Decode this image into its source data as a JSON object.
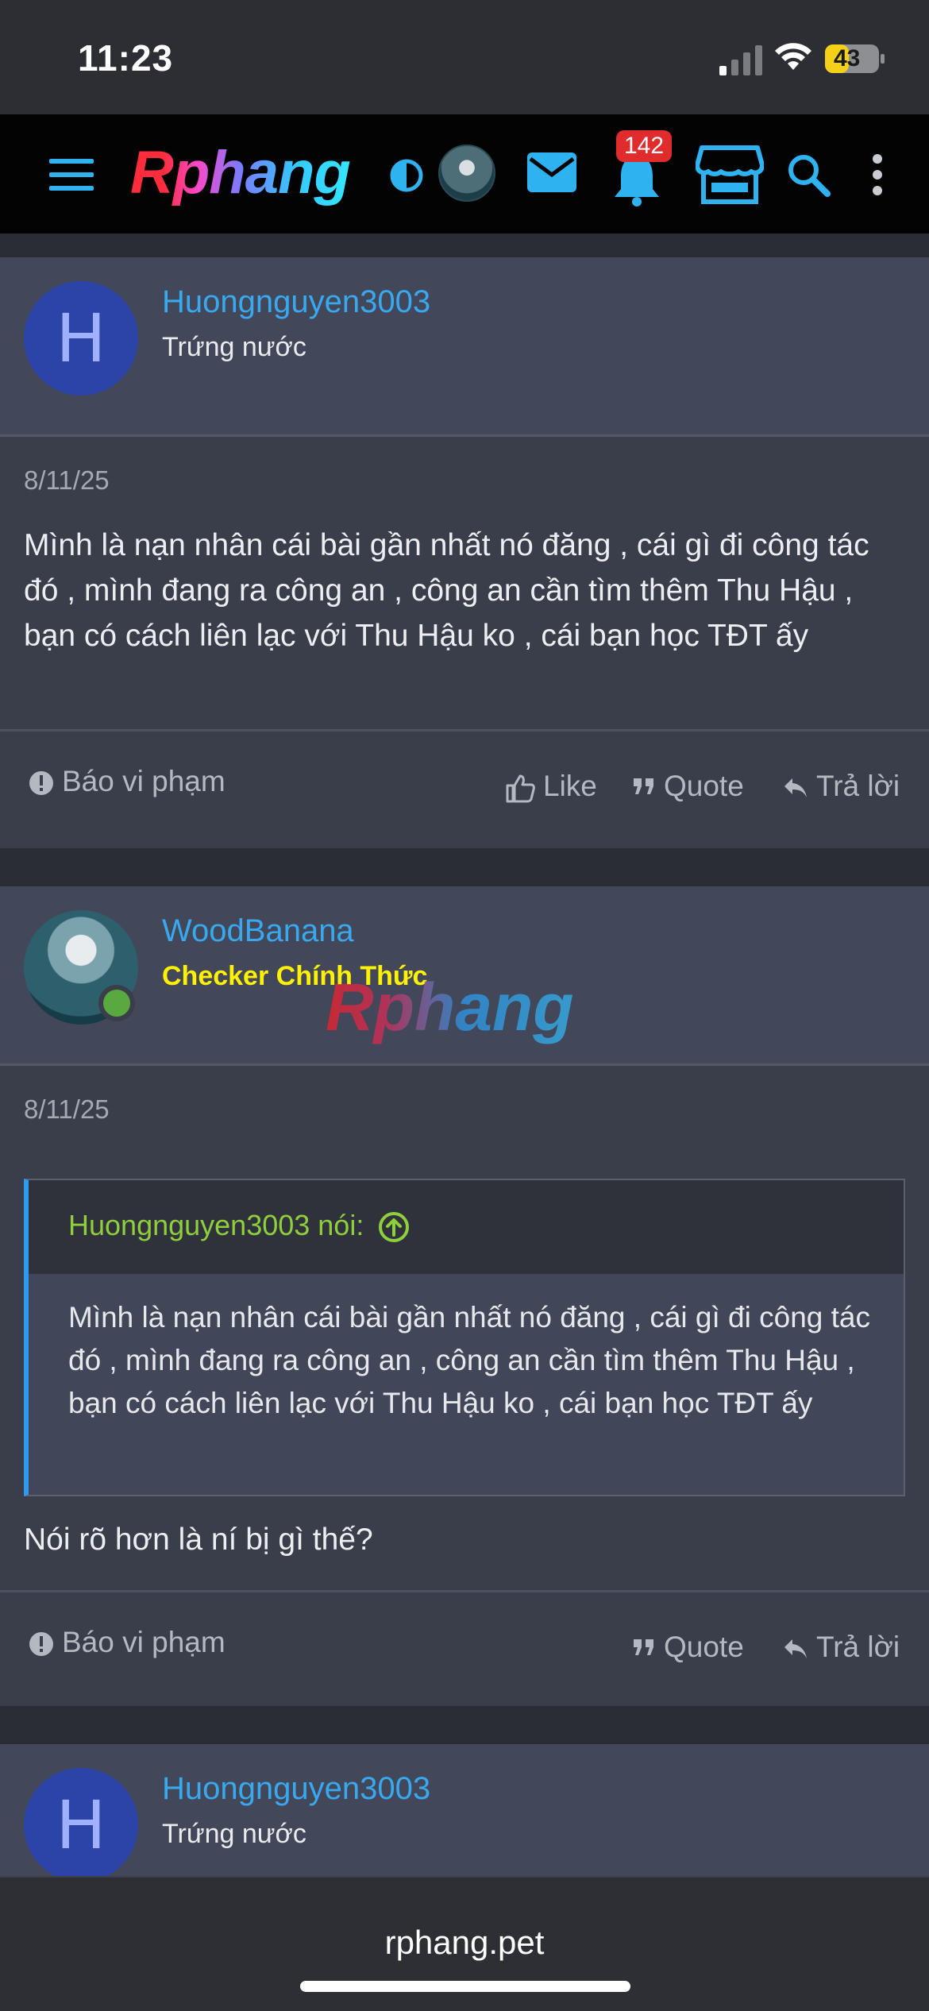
{
  "status_bar": {
    "time": "11:23",
    "battery": "43"
  },
  "nav": {
    "logo": "Rphang",
    "notification_count": "142"
  },
  "posts": [
    {
      "author": "Huongnguyen3003",
      "avatar_letter": "H",
      "user_title": "Trứng nước",
      "date": "8/11/25",
      "body": "Mình là nạn nhân cái bài gần nhất nó đăng , cái gì đi công tác đó , mình đang ra công an , công an cần tìm thêm Thu Hậu , bạn có cách liên lạc với Thu Hậu ko , cái bạn học TĐT ấy",
      "actions": {
        "report": "Báo vi phạm",
        "like": "Like",
        "quote": "Quote",
        "reply": "Trả lời"
      }
    },
    {
      "author": "WoodBanana",
      "user_title": "Checker Chính Thức",
      "date": "8/11/25",
      "quote": {
        "author": "Huongnguyen3003 nói:",
        "body": "Mình là nạn nhân cái bài gần nhất nó đăng , cái gì đi công tác đó , mình đang ra công an , công an cần tìm thêm Thu Hậu , bạn có cách liên lạc với Thu Hậu ko , cái bạn học TĐT ấy"
      },
      "body": "Nói rõ hơn là ní bị gì thế?",
      "actions": {
        "report": "Báo vi phạm",
        "quote": "Quote",
        "reply": "Trả lời"
      }
    },
    {
      "author": "Huongnguyen3003",
      "avatar_letter": "H",
      "user_title": "Trứng nước"
    }
  ],
  "watermark": "Rphang",
  "browser": {
    "url": "rphang.pet"
  },
  "colors": {
    "accent_blue": "#38a8ef",
    "checker_yellow": "#fff200",
    "quote_green": "#8fce3c",
    "badge_red": "#e02c2c"
  }
}
